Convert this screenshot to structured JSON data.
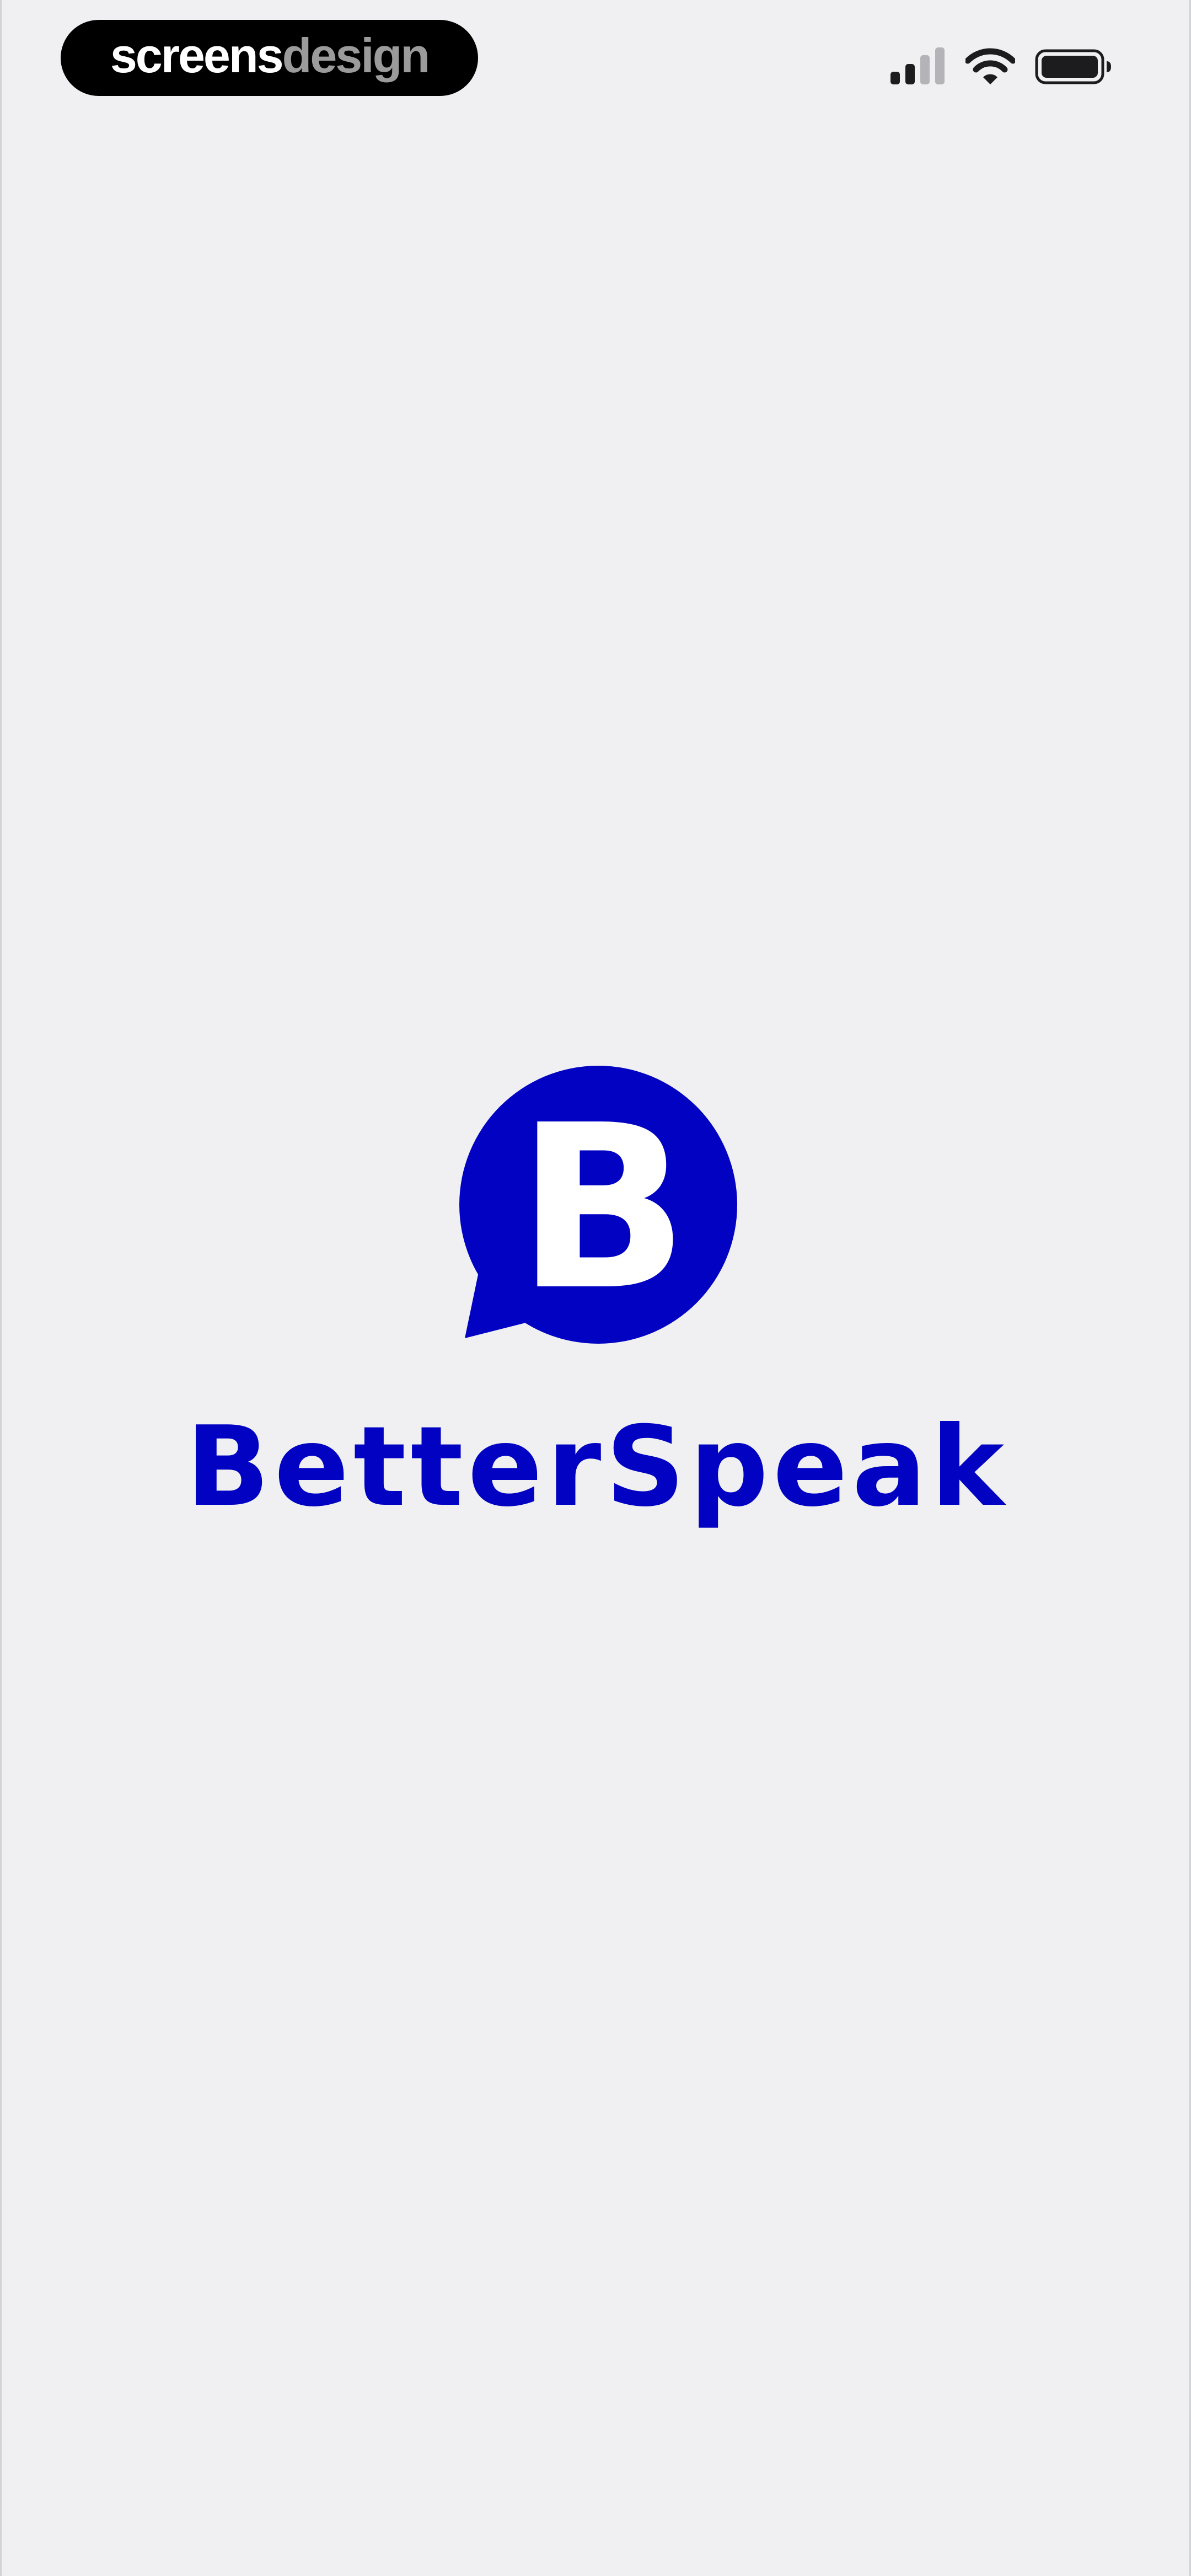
{
  "watermark": {
    "part1": "screens",
    "part2": "design"
  },
  "status_bar": {
    "icons": [
      "cellular-signal-icon",
      "wifi-icon",
      "battery-icon"
    ]
  },
  "splash": {
    "logo_letter": "B",
    "app_name": "BetterSpeak"
  },
  "colors": {
    "brand": "#0202c2",
    "background": "#f0f0f2"
  }
}
